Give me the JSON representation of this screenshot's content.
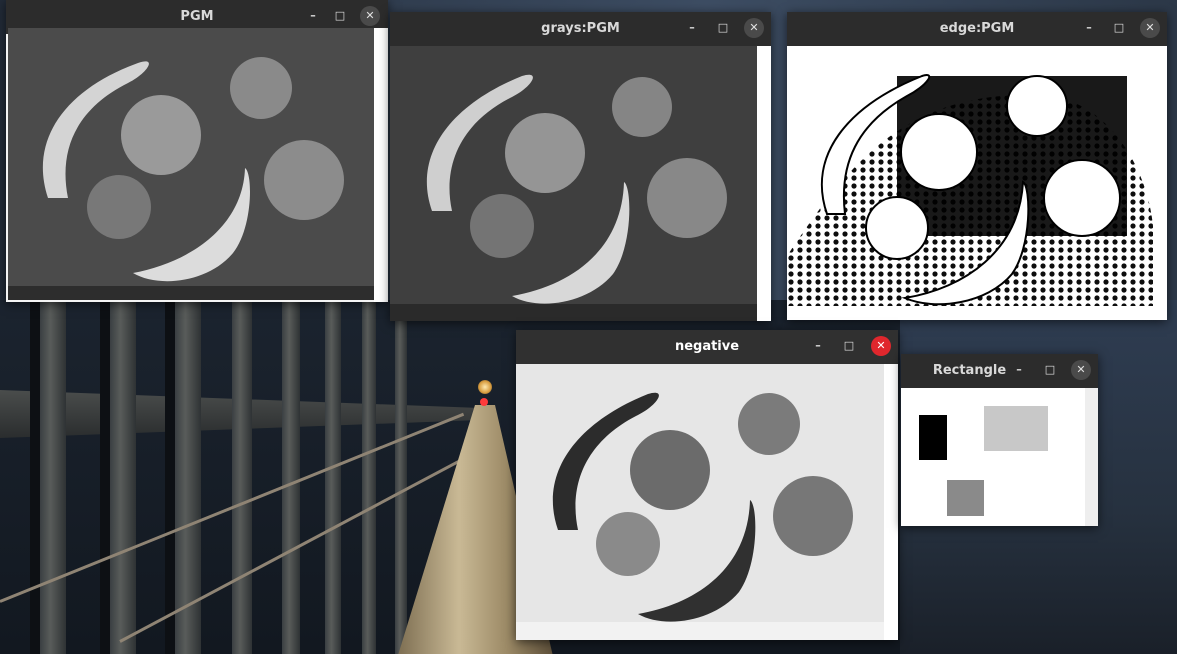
{
  "windows": {
    "pgm": {
      "title": "PGM"
    },
    "grays": {
      "title": "grays:PGM"
    },
    "edge": {
      "title": "edge:PGM"
    },
    "negative": {
      "title": "negative"
    },
    "rectangle": {
      "title": "Rectangle"
    }
  },
  "controls": {
    "minimize": "–",
    "maximize": "□",
    "close": "✕"
  },
  "colors": {
    "titlebar": "#2c2c2c",
    "close_active": "#e0272d"
  },
  "icons": [
    "minimize-icon",
    "maximize-icon",
    "close-icon"
  ]
}
